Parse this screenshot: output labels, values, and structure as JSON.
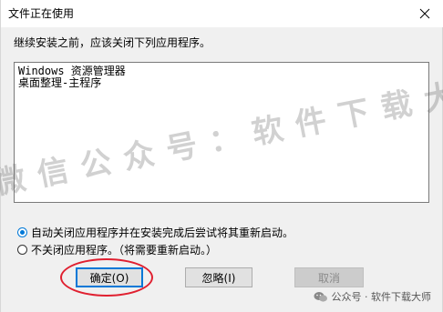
{
  "window": {
    "title": "文件正在使用",
    "close_glyph": "×"
  },
  "intro_text": "继续安装之前，应该关闭下列应用程序。",
  "apps": [
    "Windows 资源管理器",
    "桌面整理-主程序"
  ],
  "options": {
    "auto_close": {
      "label": "自动关闭应用程序并在安装完成后尝试将其重新启动。",
      "checked": true
    },
    "no_close": {
      "label": "不关闭应用程序。（将需要重新启动。）",
      "checked": false
    }
  },
  "buttons": {
    "ok": "确定(O)",
    "ignore": "忽略(I)",
    "cancel": "取消"
  },
  "watermark_text": "微信公众号：软件下载大师",
  "footer_watermark": "公众号 · 软件下载大师",
  "colors": {
    "accent": "#0078d7",
    "annotation": "#e02030"
  }
}
